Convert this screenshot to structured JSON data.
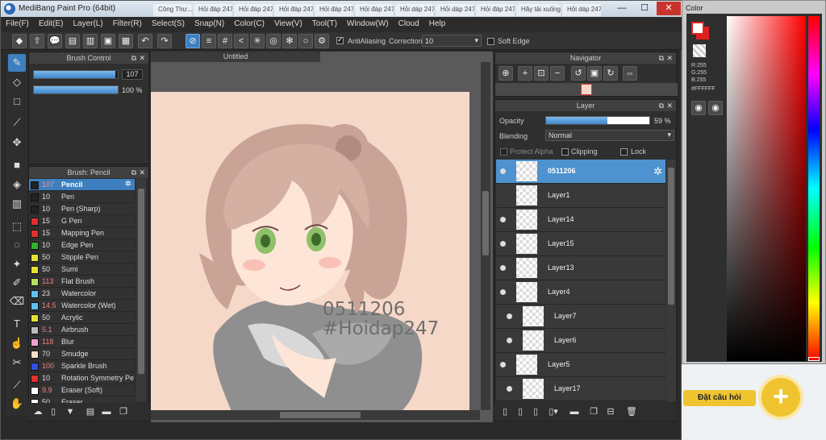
{
  "browser": {
    "tabs": [
      "Công Thư...",
      "Hỏi đáp 247 - hỏi...",
      "Hỏi đáp 247",
      "Hỏi đáp 247 - hỏi...",
      "Hỏi đáp 247",
      "Hỏi đáp 247",
      "Hỏi dáp 247",
      "Hỏi dáp 247",
      "Hỏi đáp 247",
      "Hãy tải xuống...",
      "Hỏi dáp 247"
    ]
  },
  "window": {
    "title": "MediBang Paint Pro (64bit)",
    "minimize": "—",
    "maximize": "☐",
    "close": "✕"
  },
  "menu": [
    "File(F)",
    "Edit(E)",
    "Layer(L)",
    "Filter(R)",
    "Select(S)",
    "Snap(N)",
    "Color(C)",
    "View(V)",
    "Tool(T)",
    "Window(W)",
    "Cloud",
    "Help"
  ],
  "toolbar": {
    "antialiasing_label": "AntiAliasing",
    "correction_label": "Correction",
    "correction_value": "10",
    "soft_edge_label": "Soft Edge"
  },
  "brush_control": {
    "title": "Brush Control",
    "size": "107",
    "size_fraction": 0.97,
    "opacity": "100 %",
    "opacity_fraction": 1.0
  },
  "brush_list": {
    "title": "Brush: Pencil",
    "items": [
      {
        "size": "107",
        "name": "Pencil",
        "color": "#222222",
        "selected": true
      },
      {
        "size": "10",
        "name": "Pen",
        "color": "#222222"
      },
      {
        "size": "10",
        "name": "Pen (Sharp)",
        "color": "#222222"
      },
      {
        "size": "15",
        "name": "G Pen",
        "color": "#e03030"
      },
      {
        "size": "15",
        "name": "Mapping Pen",
        "color": "#e03030"
      },
      {
        "size": "10",
        "name": "Edge Pen",
        "color": "#30b030"
      },
      {
        "size": "50",
        "name": "Stipple Pen",
        "color": "#e8e030"
      },
      {
        "size": "50",
        "name": "Sumi",
        "color": "#e8e030"
      },
      {
        "size": "113",
        "name": "Flat Brush",
        "color": "#b8e060"
      },
      {
        "size": "23",
        "name": "Watercolor",
        "color": "#60c0f0"
      },
      {
        "size": "14.5",
        "name": "Watercolor (Wet)",
        "color": "#60c0f0"
      },
      {
        "size": "50",
        "name": "Acrylic",
        "color": "#e8e030"
      },
      {
        "size": "5.1",
        "name": "Airbrush",
        "color": "#bbbbbb"
      },
      {
        "size": "118",
        "name": "Blur",
        "color": "#f0a0d0"
      },
      {
        "size": "70",
        "name": "Smudge",
        "color": "#f8e0c8"
      },
      {
        "size": "100",
        "name": "Sparkle Brush",
        "color": "#3050e0"
      },
      {
        "size": "10",
        "name": "Rotation Symmetry Pe",
        "color": "#e03030"
      },
      {
        "size": "9.9",
        "name": "Eraser (Soft)",
        "color": "#ffffff"
      },
      {
        "size": "50",
        "name": "Eraser",
        "color": "#ffffff"
      }
    ]
  },
  "canvas": {
    "tab_title": "Untitled",
    "watermark_line1": "0511206",
    "watermark_line2": "#Hoidap247"
  },
  "navigator": {
    "title": "Navigator"
  },
  "layer_panel": {
    "title": "Layer",
    "opacity_label": "Opacity",
    "opacity_value": "59 %",
    "opacity_fraction": 0.59,
    "blending_label": "Blending",
    "blending_value": "Normal",
    "protect_alpha": "Protect Alpha",
    "clipping": "Clipping",
    "lock": "Lock",
    "layers": [
      {
        "name": "0511206",
        "selected": true,
        "visible": true,
        "indent": 0
      },
      {
        "name": "Layer1",
        "visible": false,
        "indent": 0
      },
      {
        "name": "Layer14",
        "visible": true,
        "indent": 0
      },
      {
        "name": "Layer15",
        "visible": true,
        "indent": 0
      },
      {
        "name": "Layer13",
        "visible": true,
        "indent": 0
      },
      {
        "name": "Layer4",
        "visible": true,
        "indent": 0
      },
      {
        "name": "Layer7",
        "visible": true,
        "indent": 1
      },
      {
        "name": "Layer6",
        "visible": true,
        "indent": 1
      },
      {
        "name": "Layer5",
        "visible": true,
        "indent": 0
      },
      {
        "name": "Layer17",
        "visible": true,
        "indent": 1
      }
    ]
  },
  "color_window": {
    "title": "Color",
    "r": "R:255",
    "g": "G:255",
    "b": "B:255",
    "hex": "#FFFFFF",
    "primary_color": "#ffffff",
    "secondary_color": "#e02020"
  },
  "site": {
    "ask_label": "Đặt câu hỏi",
    "ask_plus": "+"
  }
}
